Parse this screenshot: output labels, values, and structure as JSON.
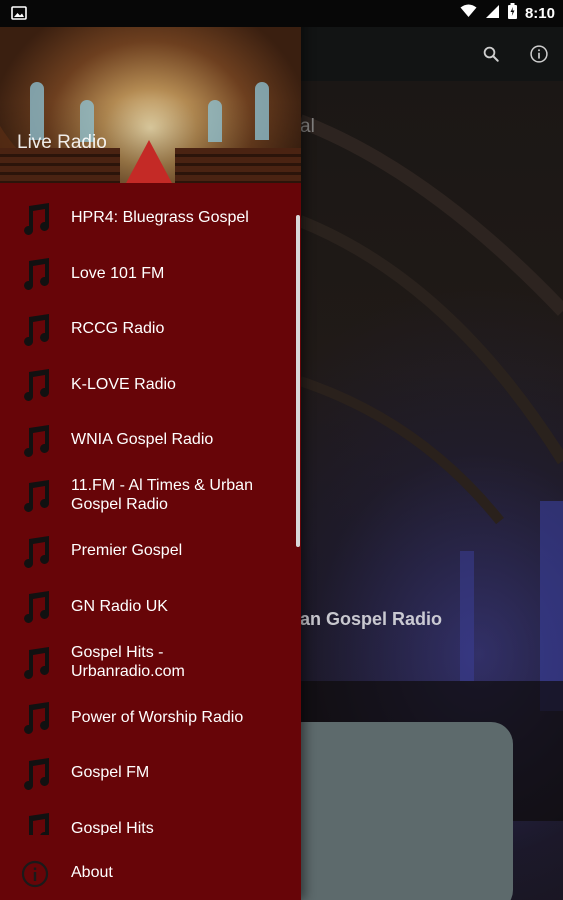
{
  "status_bar": {
    "time": "8:10"
  },
  "toolbar": {
    "search_icon": "search-icon",
    "info_icon": "info-icon"
  },
  "background": {
    "partial_title": "an Gospel Radio",
    "partial_header": "al"
  },
  "drawer": {
    "header_title": "Live Radio",
    "items": [
      {
        "label": "HPR4: Bluegrass Gospel",
        "icon": "music-note-icon"
      },
      {
        "label": "Love 101 FM",
        "icon": "music-note-icon"
      },
      {
        "label": "RCCG Radio",
        "icon": "music-note-icon"
      },
      {
        "label": "K-LOVE Radio",
        "icon": "music-note-icon"
      },
      {
        "label": "WNIA Gospel Radio",
        "icon": "music-note-icon"
      },
      {
        "label": "11.FM - Al Times & Urban Gospel Radio",
        "icon": "music-note-icon"
      },
      {
        "label": "Premier Gospel",
        "icon": "music-note-icon"
      },
      {
        "label": "GN Radio UK",
        "icon": "music-note-icon"
      },
      {
        "label": "Gospel Hits - Urbanradio.com",
        "icon": "music-note-icon"
      },
      {
        "label": "Power of Worship Radio",
        "icon": "music-note-icon"
      },
      {
        "label": "Gospel FM",
        "icon": "music-note-icon"
      },
      {
        "label": "Gospel Hits",
        "icon": "music-note-icon"
      }
    ],
    "footer": {
      "label": "About",
      "icon": "info-icon"
    }
  },
  "colors": {
    "drawer_bg": "#670508",
    "toolbar_bg": "#121414",
    "status_bar_bg": "#070707"
  }
}
